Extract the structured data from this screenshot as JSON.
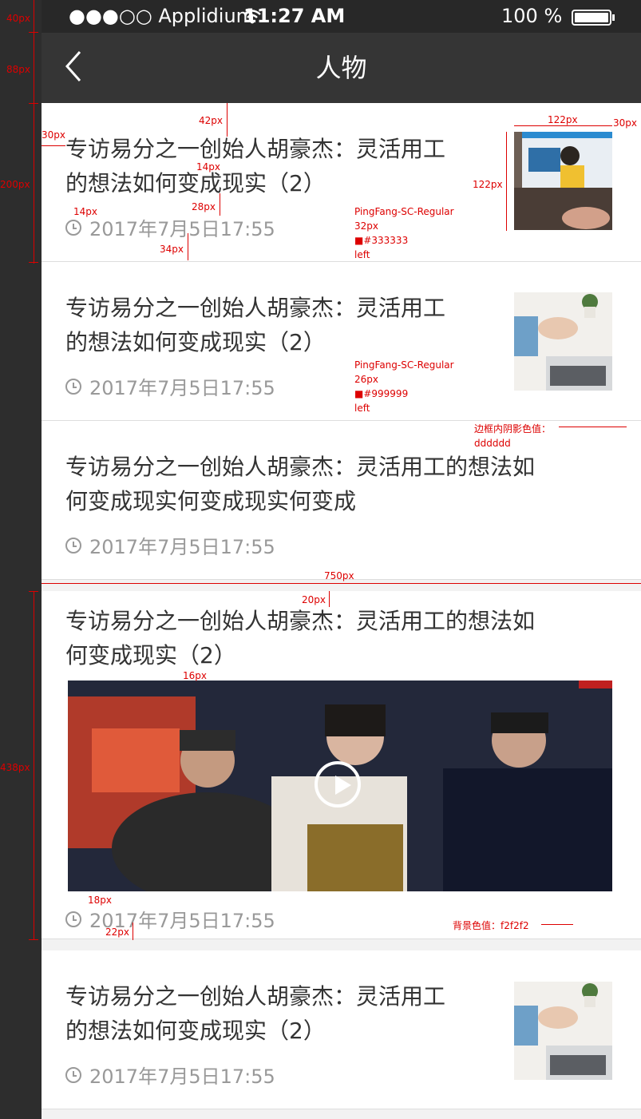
{
  "status_bar": {
    "carrier": "●●●○○ Applidium",
    "time": "11:27 AM",
    "battery": "100 %"
  },
  "nav": {
    "title": "人物",
    "back_icon": "chevron-left-icon"
  },
  "articles": [
    {
      "title_line1": "专访易分之一创始人胡豪杰：灵活用工",
      "title_line2": "的想法如何变成现实（2）",
      "meta": "2017年7月5日17:55"
    },
    {
      "title_line1": "专访易分之一创始人胡豪杰：灵活用工",
      "title_line2": "的想法如何变成现实（2）",
      "meta": "2017年7月5日17:55"
    },
    {
      "title_line1": "专访易分之一创始人胡豪杰：灵活用工的想法如",
      "title_line2": "何变成现实何变成现实何变成",
      "meta": "2017年7月5日17:55"
    },
    {
      "title_line1": "专访易分之一创始人胡豪杰：灵活用工的想法如",
      "title_line2": "何变成现实（2）",
      "meta": "2017年7月5日17:55",
      "has_video": true
    },
    {
      "title_line1": "专访易分之一创始人胡豪杰：灵活用工",
      "title_line2": "的想法如何变成现实（2）",
      "meta": "2017年7月5日17:55"
    }
  ],
  "annotations": {
    "ruler": [
      "40px",
      "88px",
      "200px",
      "438px"
    ],
    "spacing": [
      "42px",
      "14px",
      "28px",
      "34px",
      "30px",
      "122px",
      "30px",
      "122px",
      "14px",
      "750px",
      "20px",
      "16px",
      "18px",
      "22px"
    ],
    "spec_title": [
      "PingFang-SC-Regular",
      "32px",
      "■#333333",
      "left"
    ],
    "spec_meta": [
      "PingFang-SC-Regular",
      "26px",
      "■#999999",
      "left"
    ],
    "shadow_note": [
      "边框内阴影色值：",
      "dddddd"
    ],
    "bg_note": "背景色值：f2f2f2"
  },
  "colors": {
    "title": "#333333",
    "meta": "#999999",
    "shadow": "#dddddd",
    "bg": "#f2f2f2",
    "nav": "#353535"
  }
}
